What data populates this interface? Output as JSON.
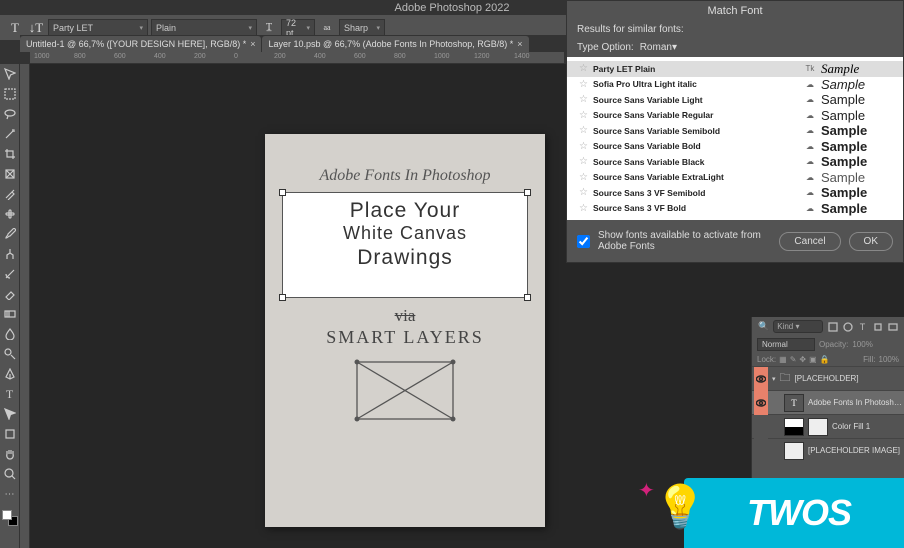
{
  "app": {
    "title": "Adobe Photoshop 2022"
  },
  "options_bar": {
    "font_family": "Party LET",
    "font_style": "Plain",
    "size_icon": "T",
    "size_value": "72 pt",
    "aa_label": "aa",
    "aa_value": "Sharp"
  },
  "tabs": [
    {
      "label": "Untitled-1 @ 66,7% ([YOUR DESIGN HERE], RGB/8) *"
    },
    {
      "label": "Layer 10.psb @ 66,7% (Adobe Fonts In Photoshop, RGB/8) *"
    }
  ],
  "ruler": {
    "marks": [
      "1000",
      "800",
      "600",
      "400",
      "200",
      "0",
      "200",
      "400",
      "600",
      "800",
      "1000",
      "1200",
      "1400"
    ]
  },
  "document": {
    "heading": "Adobe Fonts In Photoshop",
    "frame_line1": "Place Your",
    "frame_line2": "White Canvas",
    "frame_line3": "Drawings",
    "via": "via",
    "smart": "SMART LAYERS"
  },
  "match_font": {
    "title": "Match Font",
    "results_label": "Results for similar fonts:",
    "type_option_label": "Type Option:",
    "type_option_value": "Roman",
    "fonts": [
      {
        "name": "Party LET Plain",
        "icon": "Tk",
        "sample": "Sample",
        "cls": "sample-1"
      },
      {
        "name": "Sofia Pro Ultra Light italic",
        "icon": "☁",
        "sample": "Sample",
        "cls": "sample-2"
      },
      {
        "name": "Source Sans Variable Light",
        "icon": "☁",
        "sample": "Sample",
        "cls": "sample-3"
      },
      {
        "name": "Source Sans Variable Regular",
        "icon": "☁",
        "sample": "Sample",
        "cls": "sample-4"
      },
      {
        "name": "Source Sans Variable Semibold",
        "icon": "☁",
        "sample": "Sample",
        "cls": "sample-5"
      },
      {
        "name": "Source Sans Variable Bold",
        "icon": "☁",
        "sample": "Sample",
        "cls": "sample-6"
      },
      {
        "name": "Source Sans Variable Black",
        "icon": "☁",
        "sample": "Sample",
        "cls": "sample-7"
      },
      {
        "name": "Source Sans Variable ExtraLight",
        "icon": "☁",
        "sample": "Sample",
        "cls": "sample-8"
      },
      {
        "name": "Source Sans 3 VF Semibold",
        "icon": "☁",
        "sample": "Sample",
        "cls": "sample-9"
      },
      {
        "name": "Source Sans 3 VF Bold",
        "icon": "☁",
        "sample": "Sample",
        "cls": "sample-10"
      }
    ],
    "checkbox_label": "Show fonts available to activate from Adobe Fonts",
    "cancel": "Cancel",
    "ok": "OK"
  },
  "layers_panel": {
    "search_placeholder": "Kind",
    "blend_mode": "Normal",
    "opacity_label": "Opacity:",
    "opacity_value": "100%",
    "lock_label": "Lock:",
    "fill_label": "Fill:",
    "fill_value": "100%",
    "layers": [
      {
        "name": "[PLACEHOLDER]",
        "eye": true,
        "thumb": "folder"
      },
      {
        "name": "Adobe Fonts In Photoshop",
        "eye": true,
        "thumb": "T"
      },
      {
        "name": "Color Fill 1",
        "eye": false,
        "thumb": "bw"
      },
      {
        "name": "[PLACEHOLDER IMAGE]",
        "eye": false,
        "thumb": "img"
      }
    ]
  },
  "watermark": {
    "text": "TWOS"
  }
}
